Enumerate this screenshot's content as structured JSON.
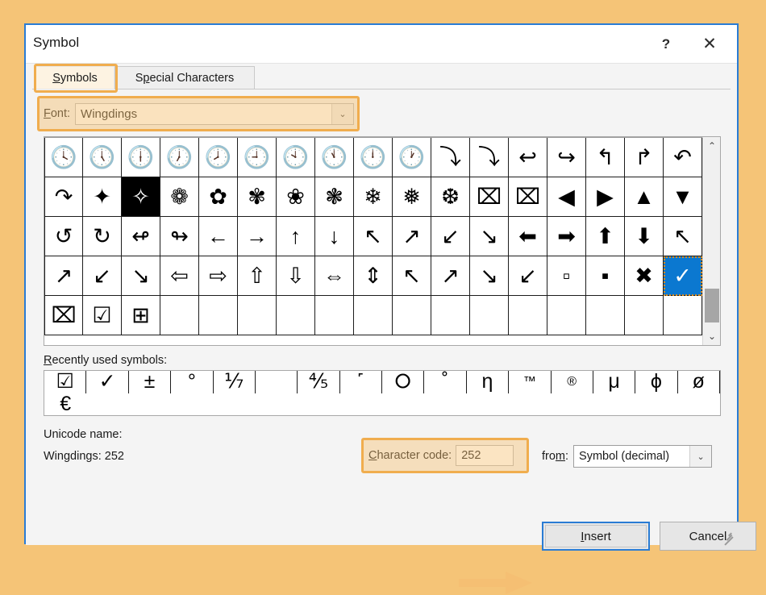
{
  "window": {
    "title": "Symbol",
    "help_label": "?",
    "close_label": "✕"
  },
  "tabs": [
    {
      "id": "symbols",
      "label": "Symbols",
      "active": true,
      "accesskey": "S"
    },
    {
      "id": "special",
      "label": "Special Characters",
      "active": false,
      "accesskey": "p"
    }
  ],
  "font": {
    "label": "Font:",
    "label_pre": "F",
    "label_post": "ont:",
    "value": "Wingdings",
    "dropdown_icon": "chevron-down-icon",
    "dropdown_glyph": "⌄"
  },
  "grid": {
    "columns": 17,
    "rows": 5,
    "selected_index": 67,
    "cells": [
      "🕓",
      "🕔",
      "🕕",
      "🕖",
      "🕗",
      "🕘",
      "🕙",
      "🕚",
      "🕛",
      "🕐",
      "⤵",
      "⤵",
      "↩",
      "↪",
      "↰",
      "↱",
      "↶",
      "↷",
      "✦",
      "✧",
      "❁",
      "✿",
      "✾",
      "❀",
      "❃",
      "❄",
      "❅",
      "❆",
      "⌧",
      "⌧",
      "◀",
      "▶",
      "▲",
      "▼",
      "↺",
      "↻",
      "↫",
      "↬",
      "←",
      "→",
      "↑",
      "↓",
      "↖",
      "↗",
      "↙",
      "↘",
      "⬅",
      "➡",
      "⬆",
      "⬇",
      "↖",
      "↗",
      "↙",
      "↘",
      "⇦",
      "⇨",
      "⇧",
      "⇩",
      "⇔",
      "⇕",
      "↖",
      "↗",
      "↘",
      "↙",
      "▫",
      "▪",
      "✖",
      "✓",
      "⌧",
      "☑",
      "⊞",
      "",
      "",
      "",
      "",
      "",
      "",
      "",
      "",
      "",
      "",
      "",
      "",
      "",
      ""
    ],
    "scrollbar": {
      "up_icon": "chevron-up-icon",
      "down_icon": "chevron-down-icon",
      "up_glyph": "⌃",
      "down_glyph": "⌄"
    }
  },
  "recent": {
    "label": "Recently used symbols:",
    "label_pre": "R",
    "label_post": "ecently used symbols:",
    "symbols": [
      "☑",
      "✓",
      "±",
      "°",
      "⅐",
      "",
      "⅘",
      "˹",
      "⭘",
      "˚",
      "η",
      "™",
      "®",
      "μ",
      "ϕ",
      "ø",
      "€"
    ]
  },
  "unicode": {
    "name_label": "Unicode name:",
    "value": "Wingdings: 252"
  },
  "character_code": {
    "label": "Character code:",
    "label_pre": "C",
    "label_post": "haracter code:",
    "value": "252"
  },
  "from": {
    "label": "from:",
    "label_a": "fro",
    "label_b": "m",
    "label_c": ":",
    "value": "Symbol (decimal)",
    "dropdown_icon": "chevron-down-icon",
    "dropdown_glyph": "⌄"
  },
  "footer": {
    "insert_pre": "",
    "insert_key": "I",
    "insert_post": "nsert",
    "insert_label": "Insert",
    "cancel_label": "Cancel"
  },
  "annotation": {
    "arrow_color": "#f5bf73",
    "highlight_color": "#f0ad4e"
  },
  "colors": {
    "page_background": "#f5c477",
    "dialog_border": "#2a7cd4",
    "selection_blue": "#0b78d0",
    "focus_orange": "#d98c1f"
  }
}
